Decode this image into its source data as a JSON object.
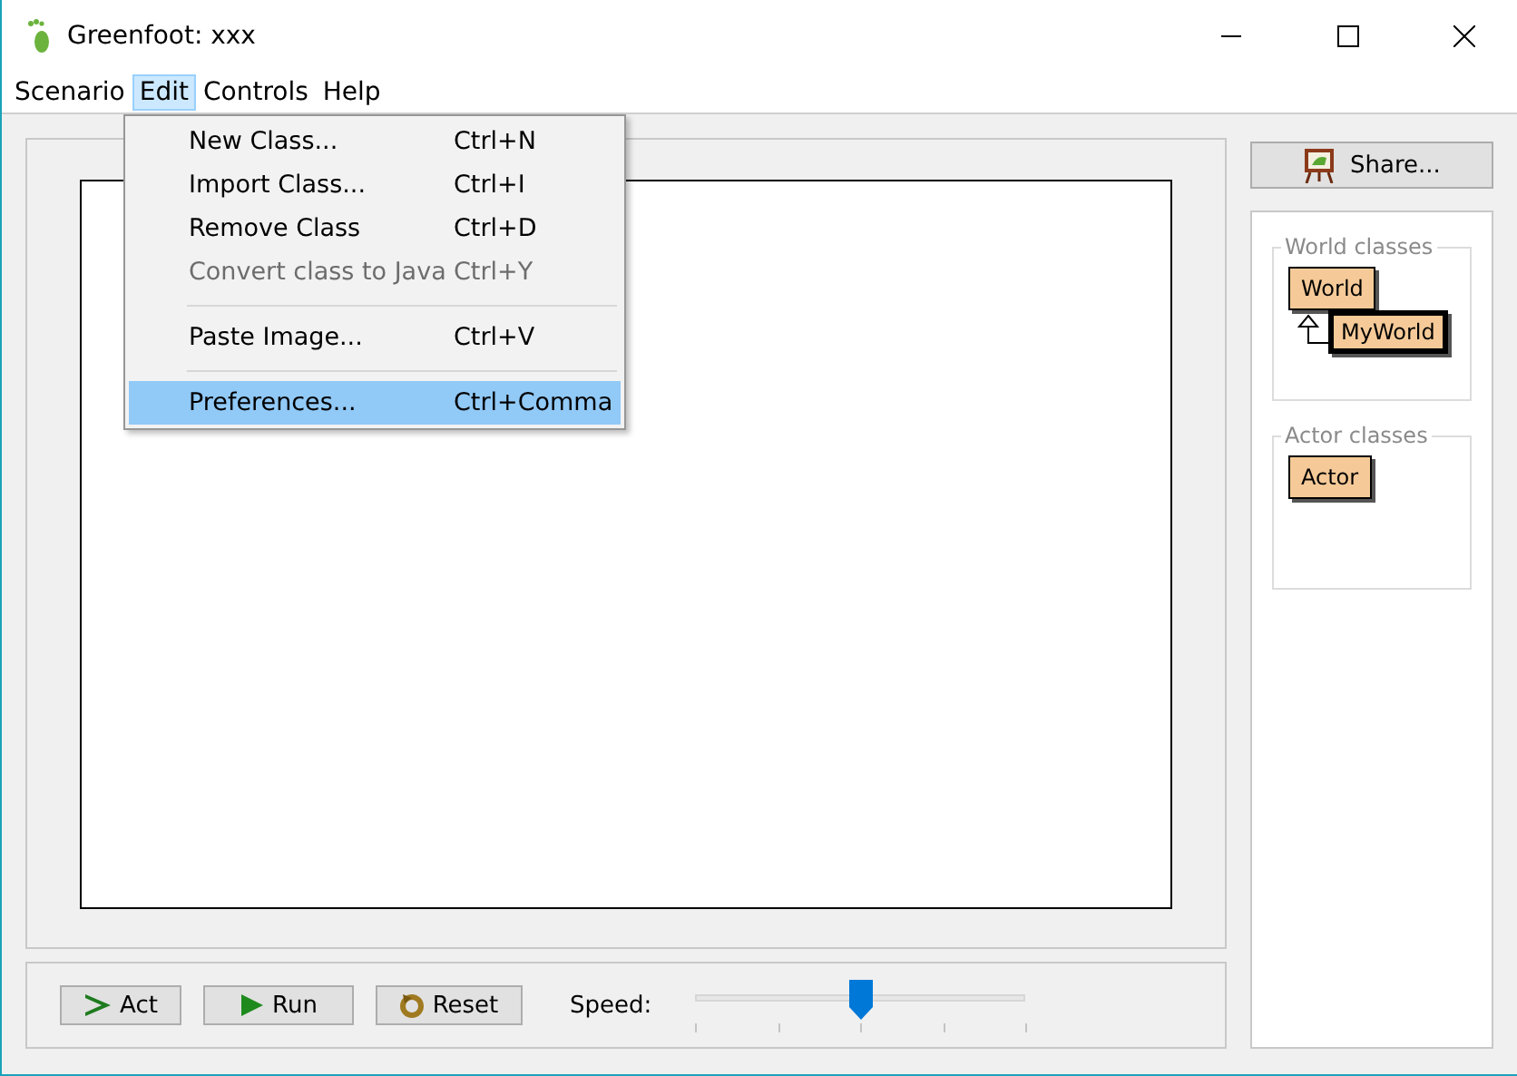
{
  "window": {
    "title": "Greenfoot: xxx"
  },
  "menu_bar": [
    {
      "label": "Scenario",
      "selected": false
    },
    {
      "label": "Edit",
      "selected": true
    },
    {
      "label": "Controls",
      "selected": false
    },
    {
      "label": "Help",
      "selected": false
    }
  ],
  "edit_menu": {
    "items": [
      {
        "kind": "item",
        "label": "New Class...",
        "shortcut": "Ctrl+N",
        "disabled": false,
        "selected": false
      },
      {
        "kind": "item",
        "label": "Import Class...",
        "shortcut": "Ctrl+I",
        "disabled": false,
        "selected": false
      },
      {
        "kind": "item",
        "label": "Remove Class",
        "shortcut": "Ctrl+D",
        "disabled": false,
        "selected": false
      },
      {
        "kind": "item",
        "label": "Convert class to Java",
        "shortcut": "Ctrl+Y",
        "disabled": true,
        "selected": false
      },
      {
        "kind": "separator"
      },
      {
        "kind": "item",
        "label": "Paste Image...",
        "shortcut": "Ctrl+V",
        "disabled": false,
        "selected": false
      },
      {
        "kind": "separator"
      },
      {
        "kind": "item",
        "label": "Preferences...",
        "shortcut": "Ctrl+Comma",
        "disabled": false,
        "selected": true
      }
    ]
  },
  "share_button": {
    "label": "Share..."
  },
  "world_classes": {
    "title": "World classes",
    "classes": [
      {
        "name": "World",
        "selected": false,
        "children": [
          {
            "name": "MyWorld",
            "selected": true
          }
        ]
      }
    ]
  },
  "actor_classes": {
    "title": "Actor classes",
    "classes": [
      {
        "name": "Actor",
        "selected": false
      }
    ]
  },
  "controls": {
    "buttons": [
      {
        "label": "Act",
        "kind": "act"
      },
      {
        "label": "Run",
        "kind": "run"
      },
      {
        "label": "Reset",
        "kind": "reset"
      }
    ],
    "speed": {
      "label": "Speed:",
      "level": 0.5
    }
  }
}
